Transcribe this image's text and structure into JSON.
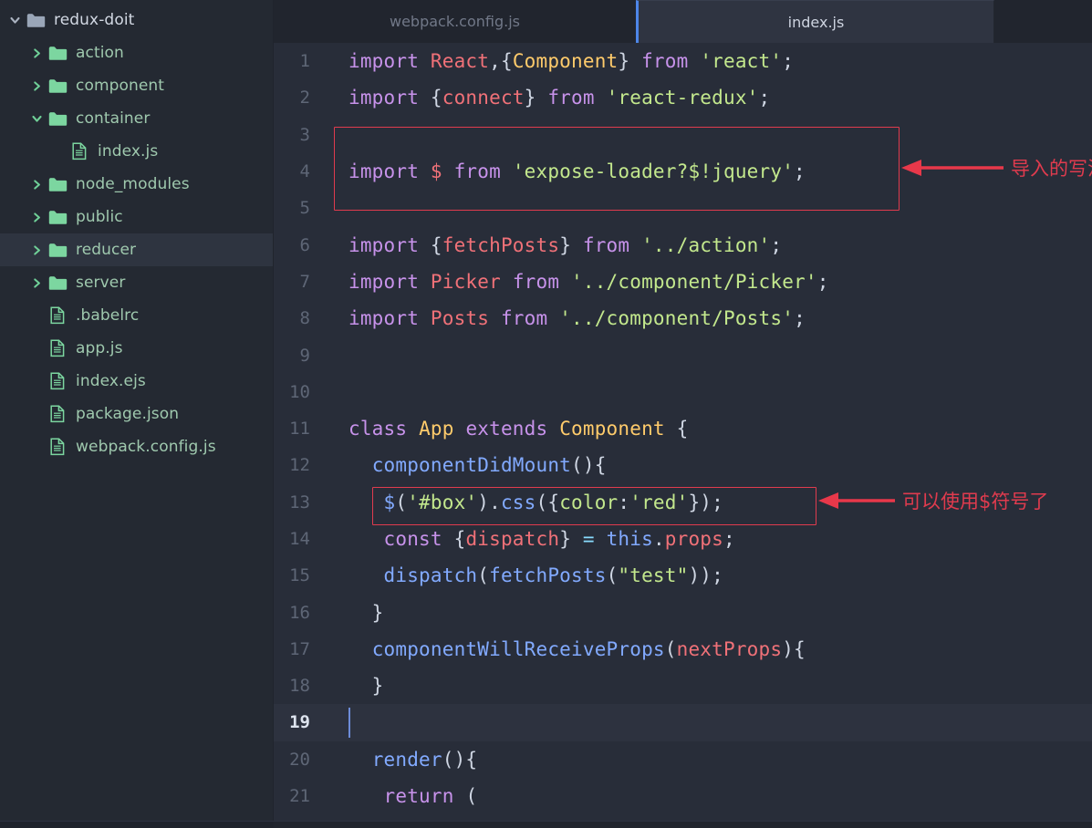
{
  "sidebar": {
    "items": [
      {
        "label": "redux-doit",
        "type": "folder-root",
        "indent": 0,
        "expanded": true,
        "selected": false,
        "icon": "folder-open-icon"
      },
      {
        "label": "action",
        "type": "folder",
        "indent": 1,
        "expanded": false,
        "selected": false,
        "icon": "folder-icon"
      },
      {
        "label": "component",
        "type": "folder",
        "indent": 1,
        "expanded": false,
        "selected": false,
        "icon": "folder-icon"
      },
      {
        "label": "container",
        "type": "folder",
        "indent": 1,
        "expanded": true,
        "selected": false,
        "icon": "folder-icon"
      },
      {
        "label": "index.js",
        "type": "file",
        "indent": 2,
        "expanded": null,
        "selected": false,
        "icon": "file-icon"
      },
      {
        "label": "node_modules",
        "type": "folder",
        "indent": 1,
        "expanded": false,
        "selected": false,
        "icon": "folder-icon"
      },
      {
        "label": "public",
        "type": "folder",
        "indent": 1,
        "expanded": false,
        "selected": false,
        "icon": "folder-icon"
      },
      {
        "label": "reducer",
        "type": "folder",
        "indent": 1,
        "expanded": false,
        "selected": true,
        "icon": "folder-icon"
      },
      {
        "label": "server",
        "type": "folder",
        "indent": 1,
        "expanded": false,
        "selected": false,
        "icon": "folder-icon"
      },
      {
        "label": ".babelrc",
        "type": "file",
        "indent": 1,
        "expanded": null,
        "selected": false,
        "icon": "file-icon"
      },
      {
        "label": "app.js",
        "type": "file",
        "indent": 1,
        "expanded": null,
        "selected": false,
        "icon": "file-icon"
      },
      {
        "label": "index.ejs",
        "type": "file",
        "indent": 1,
        "expanded": null,
        "selected": false,
        "icon": "file-icon"
      },
      {
        "label": "package.json",
        "type": "file",
        "indent": 1,
        "expanded": null,
        "selected": false,
        "icon": "file-icon"
      },
      {
        "label": "webpack.config.js",
        "type": "file",
        "indent": 1,
        "expanded": null,
        "selected": false,
        "icon": "file-icon"
      }
    ]
  },
  "tabs": [
    {
      "label": "webpack.config.js",
      "active": false
    },
    {
      "label": "index.js",
      "active": true
    }
  ],
  "editor": {
    "current_line": 19,
    "lines": [
      {
        "n": 1,
        "tokens": [
          {
            "t": "import ",
            "c": "kw"
          },
          {
            "t": "React",
            "c": "var"
          },
          {
            "t": ",{",
            "c": "plain"
          },
          {
            "t": "Component",
            "c": "cls"
          },
          {
            "t": "} ",
            "c": "plain"
          },
          {
            "t": "from ",
            "c": "kw"
          },
          {
            "t": "'react'",
            "c": "str"
          },
          {
            "t": ";",
            "c": "plain"
          }
        ]
      },
      {
        "n": 2,
        "tokens": [
          {
            "t": "import ",
            "c": "kw"
          },
          {
            "t": "{",
            "c": "plain"
          },
          {
            "t": "connect",
            "c": "var"
          },
          {
            "t": "} ",
            "c": "plain"
          },
          {
            "t": "from ",
            "c": "kw"
          },
          {
            "t": "'react-redux'",
            "c": "str"
          },
          {
            "t": ";",
            "c": "plain"
          }
        ]
      },
      {
        "n": 3,
        "tokens": []
      },
      {
        "n": 4,
        "tokens": [
          {
            "t": "import ",
            "c": "kw"
          },
          {
            "t": "$",
            "c": "var"
          },
          {
            "t": " ",
            "c": "plain"
          },
          {
            "t": "from ",
            "c": "kw"
          },
          {
            "t": "'expose-loader?$!jquery'",
            "c": "str"
          },
          {
            "t": ";",
            "c": "plain"
          }
        ]
      },
      {
        "n": 5,
        "tokens": []
      },
      {
        "n": 6,
        "tokens": [
          {
            "t": "import ",
            "c": "kw"
          },
          {
            "t": "{",
            "c": "plain"
          },
          {
            "t": "fetchPosts",
            "c": "var"
          },
          {
            "t": "} ",
            "c": "plain"
          },
          {
            "t": "from ",
            "c": "kw"
          },
          {
            "t": "'../action'",
            "c": "str"
          },
          {
            "t": ";",
            "c": "plain"
          }
        ]
      },
      {
        "n": 7,
        "tokens": [
          {
            "t": "import ",
            "c": "kw"
          },
          {
            "t": "Picker",
            "c": "var"
          },
          {
            "t": " ",
            "c": "plain"
          },
          {
            "t": "from ",
            "c": "kw"
          },
          {
            "t": "'../component/Picker'",
            "c": "str"
          },
          {
            "t": ";",
            "c": "plain"
          }
        ]
      },
      {
        "n": 8,
        "tokens": [
          {
            "t": "import ",
            "c": "kw"
          },
          {
            "t": "Posts",
            "c": "var"
          },
          {
            "t": " ",
            "c": "plain"
          },
          {
            "t": "from ",
            "c": "kw"
          },
          {
            "t": "'../component/Posts'",
            "c": "str"
          },
          {
            "t": ";",
            "c": "plain"
          }
        ]
      },
      {
        "n": 9,
        "tokens": []
      },
      {
        "n": 10,
        "tokens": []
      },
      {
        "n": 11,
        "tokens": [
          {
            "t": "class ",
            "c": "kw"
          },
          {
            "t": "App",
            "c": "cls"
          },
          {
            "t": " ",
            "c": "plain"
          },
          {
            "t": "extends ",
            "c": "kw"
          },
          {
            "t": "Component",
            "c": "cls"
          },
          {
            "t": " {",
            "c": "plain"
          }
        ]
      },
      {
        "n": 12,
        "tokens": [
          {
            "t": "  ",
            "c": "plain"
          },
          {
            "t": "componentDidMount",
            "c": "fn"
          },
          {
            "t": "(){",
            "c": "plain"
          }
        ]
      },
      {
        "n": 13,
        "tokens": [
          {
            "t": "   ",
            "c": "plain"
          },
          {
            "t": "$",
            "c": "fn"
          },
          {
            "t": "(",
            "c": "plain"
          },
          {
            "t": "'#box'",
            "c": "str"
          },
          {
            "t": ")",
            "c": "plain"
          },
          {
            "t": ".",
            "c": "plain"
          },
          {
            "t": "css",
            "c": "fn"
          },
          {
            "t": "({",
            "c": "plain"
          },
          {
            "t": "color",
            "c": "str"
          },
          {
            "t": ":",
            "c": "plain"
          },
          {
            "t": "'red'",
            "c": "str"
          },
          {
            "t": "});",
            "c": "plain"
          }
        ]
      },
      {
        "n": 14,
        "tokens": [
          {
            "t": "   ",
            "c": "plain"
          },
          {
            "t": "const ",
            "c": "kw"
          },
          {
            "t": "{",
            "c": "plain"
          },
          {
            "t": "dispatch",
            "c": "var"
          },
          {
            "t": "} ",
            "c": "plain"
          },
          {
            "t": "=",
            "c": "op"
          },
          {
            "t": " ",
            "c": "plain"
          },
          {
            "t": "this",
            "c": "fn"
          },
          {
            "t": ".",
            "c": "plain"
          },
          {
            "t": "props",
            "c": "var"
          },
          {
            "t": ";",
            "c": "plain"
          }
        ]
      },
      {
        "n": 15,
        "tokens": [
          {
            "t": "   ",
            "c": "plain"
          },
          {
            "t": "dispatch",
            "c": "fn"
          },
          {
            "t": "(",
            "c": "plain"
          },
          {
            "t": "fetchPosts",
            "c": "fn"
          },
          {
            "t": "(",
            "c": "plain"
          },
          {
            "t": "\"test\"",
            "c": "str"
          },
          {
            "t": "));",
            "c": "plain"
          }
        ]
      },
      {
        "n": 16,
        "tokens": [
          {
            "t": "  }",
            "c": "plain"
          }
        ]
      },
      {
        "n": 17,
        "tokens": [
          {
            "t": "  ",
            "c": "plain"
          },
          {
            "t": "componentWillReceiveProps",
            "c": "fn"
          },
          {
            "t": "(",
            "c": "plain"
          },
          {
            "t": "nextProps",
            "c": "var"
          },
          {
            "t": "){",
            "c": "plain"
          }
        ]
      },
      {
        "n": 18,
        "tokens": [
          {
            "t": "  }",
            "c": "plain"
          }
        ]
      },
      {
        "n": 19,
        "tokens": []
      },
      {
        "n": 20,
        "tokens": [
          {
            "t": "  ",
            "c": "plain"
          },
          {
            "t": "render",
            "c": "fn"
          },
          {
            "t": "(){",
            "c": "plain"
          }
        ]
      },
      {
        "n": 21,
        "tokens": [
          {
            "t": "   ",
            "c": "plain"
          },
          {
            "t": "return ",
            "c": "kw"
          },
          {
            "t": "(",
            "c": "plain"
          }
        ]
      }
    ]
  },
  "annotations": [
    {
      "id": "import",
      "text": "导入的写法",
      "color": "#e03b4e",
      "target_line": 4
    },
    {
      "id": "css",
      "text": "可以使用$符号了",
      "color": "#e03b4e",
      "target_line": 13
    }
  ],
  "colors": {
    "sidebar_bg": "#242932",
    "editor_bg": "#282d39",
    "tab_active_bg": "#2f3441",
    "tab_accent": "#4d86e8",
    "selection_bg": "#2e3440",
    "annotation_red": "#e03b4e",
    "folder_green": "#7cd6a0",
    "keyword_purple": "#c792ea",
    "string_green": "#c3e88d",
    "class_yellow": "#ffcb6b",
    "variable_red": "#f07178",
    "function_blue": "#82aaff"
  }
}
